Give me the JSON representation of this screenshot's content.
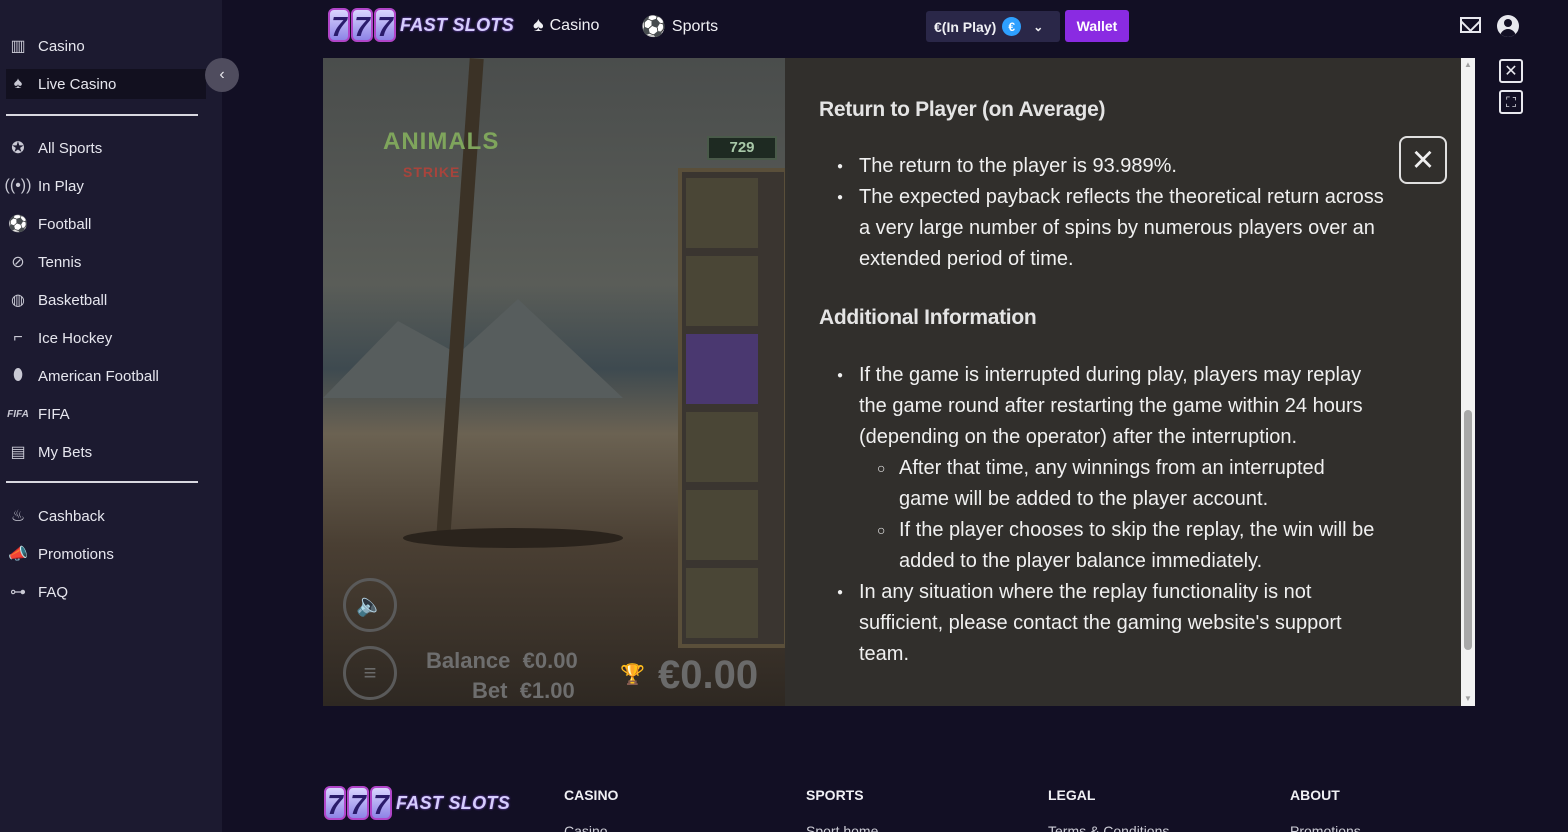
{
  "sidebar": {
    "items": [
      {
        "label": "Casino",
        "icon": "slot-machine-icon"
      },
      {
        "label": "Live Casino",
        "icon": "cards-icon"
      },
      {
        "label": "All Sports",
        "icon": "all-sports-icon"
      },
      {
        "label": "In Play",
        "icon": "broadcast-icon"
      },
      {
        "label": "Football",
        "icon": "football-icon"
      },
      {
        "label": "Tennis",
        "icon": "tennis-icon"
      },
      {
        "label": "Basketball",
        "icon": "basketball-icon"
      },
      {
        "label": "Ice Hockey",
        "icon": "hockey-icon"
      },
      {
        "label": "American Football",
        "icon": "american-football-icon"
      },
      {
        "label": "FIFA",
        "icon": "fifa-icon"
      },
      {
        "label": "My Bets",
        "icon": "bets-icon"
      },
      {
        "label": "Cashback",
        "icon": "flame-icon"
      },
      {
        "label": "Promotions",
        "icon": "megaphone-icon"
      },
      {
        "label": "FAQ",
        "icon": "whistle-icon"
      }
    ],
    "fifa_icon_text": "FIFA"
  },
  "header": {
    "logo_digits": [
      "7",
      "7",
      "7"
    ],
    "logo_text": "FAST SLOTS",
    "casino_label": "Casino",
    "sports_label": "Sports",
    "balance_label": "€(In Play)",
    "currency_symbol": "€",
    "wallet_label": "Wallet"
  },
  "game": {
    "title_logo": "ANIMALS",
    "title_sub": "STRIKE",
    "counter": "729",
    "balance_label": "Balance",
    "balance_value": "€0.00",
    "bet_label": "Bet",
    "bet_value": "€1.00",
    "win_value": "€0.00"
  },
  "info_panel": {
    "rtp_heading": "Return to Player (on Average)",
    "rtp_items": [
      "The return to the player is 93.989%.",
      "The expected payback reflects the theoretical return across a very large number of spins by numerous players over an extended period of time."
    ],
    "additional_heading": "Additional Information",
    "additional_item_1": "If the game is interrupted during play, players may replay the game round after restarting the game within 24 hours (depending on the operator) after the interruption.",
    "additional_sub_1": "After that time, any winnings from an interrupted game will be added to the player account.",
    "additional_sub_2": "If the player chooses to skip the replay, the win will be added to the player balance immediately.",
    "additional_item_2": "In any situation where the replay functionality is not sufficient, please contact the gaming website's support team."
  },
  "footer": {
    "logo_text": "FAST SLOTS",
    "columns": [
      {
        "heading": "CASINO",
        "first_link": "Casino"
      },
      {
        "heading": "SPORTS",
        "first_link": "Sport home"
      },
      {
        "heading": "LEGAL",
        "first_link": "Terms & Conditions"
      },
      {
        "heading": "ABOUT",
        "first_link": "Promotions"
      }
    ]
  },
  "colors": {
    "sidebar_bg": "#1c1a30",
    "page_bg": "#120f24",
    "wallet_accent": "#8a2be2",
    "coin_blue": "#2ea0ff"
  }
}
